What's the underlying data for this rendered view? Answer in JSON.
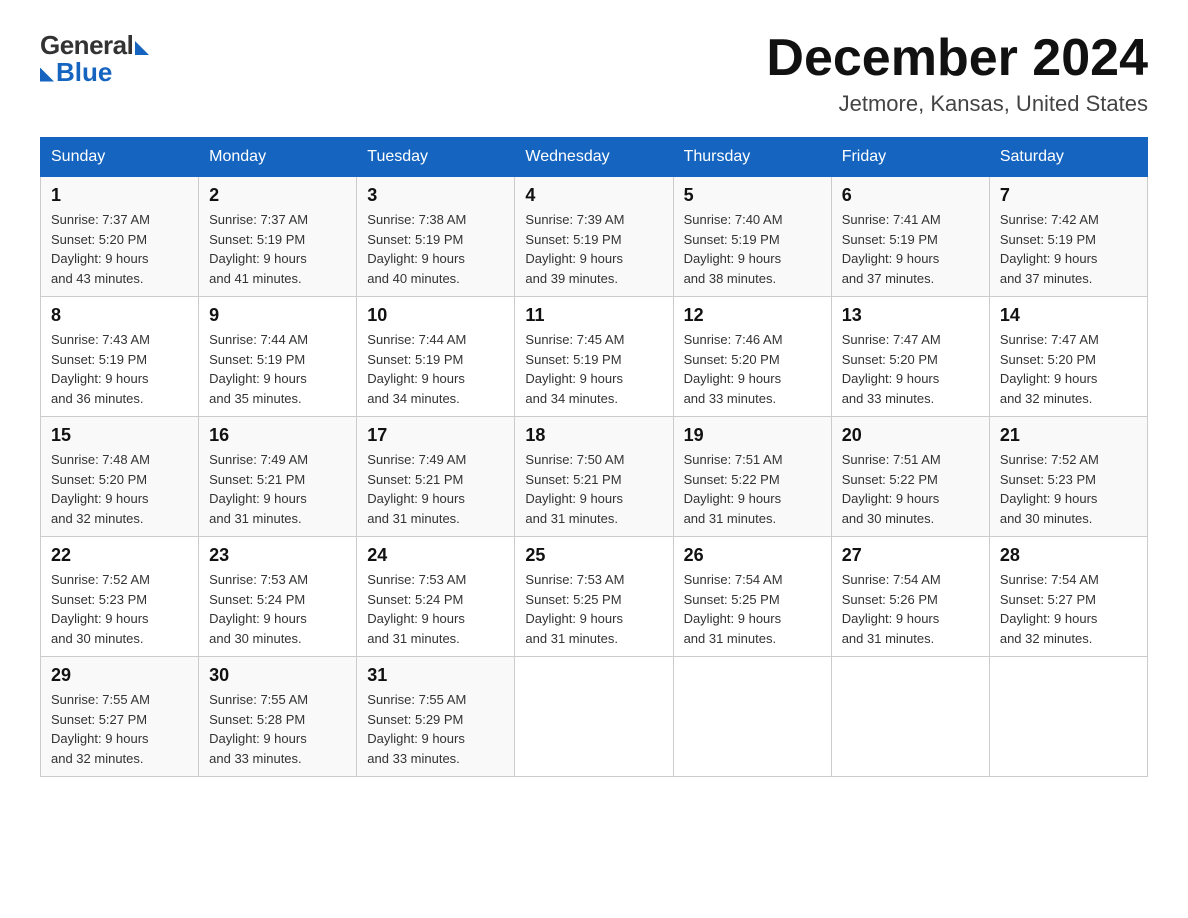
{
  "logo": {
    "general": "General",
    "blue": "Blue"
  },
  "header": {
    "month": "December 2024",
    "location": "Jetmore, Kansas, United States"
  },
  "weekdays": [
    "Sunday",
    "Monday",
    "Tuesday",
    "Wednesday",
    "Thursday",
    "Friday",
    "Saturday"
  ],
  "weeks": [
    [
      {
        "day": "1",
        "sunrise": "7:37 AM",
        "sunset": "5:20 PM",
        "daylight": "9 hours and 43 minutes."
      },
      {
        "day": "2",
        "sunrise": "7:37 AM",
        "sunset": "5:19 PM",
        "daylight": "9 hours and 41 minutes."
      },
      {
        "day": "3",
        "sunrise": "7:38 AM",
        "sunset": "5:19 PM",
        "daylight": "9 hours and 40 minutes."
      },
      {
        "day": "4",
        "sunrise": "7:39 AM",
        "sunset": "5:19 PM",
        "daylight": "9 hours and 39 minutes."
      },
      {
        "day": "5",
        "sunrise": "7:40 AM",
        "sunset": "5:19 PM",
        "daylight": "9 hours and 38 minutes."
      },
      {
        "day": "6",
        "sunrise": "7:41 AM",
        "sunset": "5:19 PM",
        "daylight": "9 hours and 37 minutes."
      },
      {
        "day": "7",
        "sunrise": "7:42 AM",
        "sunset": "5:19 PM",
        "daylight": "9 hours and 37 minutes."
      }
    ],
    [
      {
        "day": "8",
        "sunrise": "7:43 AM",
        "sunset": "5:19 PM",
        "daylight": "9 hours and 36 minutes."
      },
      {
        "day": "9",
        "sunrise": "7:44 AM",
        "sunset": "5:19 PM",
        "daylight": "9 hours and 35 minutes."
      },
      {
        "day": "10",
        "sunrise": "7:44 AM",
        "sunset": "5:19 PM",
        "daylight": "9 hours and 34 minutes."
      },
      {
        "day": "11",
        "sunrise": "7:45 AM",
        "sunset": "5:19 PM",
        "daylight": "9 hours and 34 minutes."
      },
      {
        "day": "12",
        "sunrise": "7:46 AM",
        "sunset": "5:20 PM",
        "daylight": "9 hours and 33 minutes."
      },
      {
        "day": "13",
        "sunrise": "7:47 AM",
        "sunset": "5:20 PM",
        "daylight": "9 hours and 33 minutes."
      },
      {
        "day": "14",
        "sunrise": "7:47 AM",
        "sunset": "5:20 PM",
        "daylight": "9 hours and 32 minutes."
      }
    ],
    [
      {
        "day": "15",
        "sunrise": "7:48 AM",
        "sunset": "5:20 PM",
        "daylight": "9 hours and 32 minutes."
      },
      {
        "day": "16",
        "sunrise": "7:49 AM",
        "sunset": "5:21 PM",
        "daylight": "9 hours and 31 minutes."
      },
      {
        "day": "17",
        "sunrise": "7:49 AM",
        "sunset": "5:21 PM",
        "daylight": "9 hours and 31 minutes."
      },
      {
        "day": "18",
        "sunrise": "7:50 AM",
        "sunset": "5:21 PM",
        "daylight": "9 hours and 31 minutes."
      },
      {
        "day": "19",
        "sunrise": "7:51 AM",
        "sunset": "5:22 PM",
        "daylight": "9 hours and 31 minutes."
      },
      {
        "day": "20",
        "sunrise": "7:51 AM",
        "sunset": "5:22 PM",
        "daylight": "9 hours and 30 minutes."
      },
      {
        "day": "21",
        "sunrise": "7:52 AM",
        "sunset": "5:23 PM",
        "daylight": "9 hours and 30 minutes."
      }
    ],
    [
      {
        "day": "22",
        "sunrise": "7:52 AM",
        "sunset": "5:23 PM",
        "daylight": "9 hours and 30 minutes."
      },
      {
        "day": "23",
        "sunrise": "7:53 AM",
        "sunset": "5:24 PM",
        "daylight": "9 hours and 30 minutes."
      },
      {
        "day": "24",
        "sunrise": "7:53 AM",
        "sunset": "5:24 PM",
        "daylight": "9 hours and 31 minutes."
      },
      {
        "day": "25",
        "sunrise": "7:53 AM",
        "sunset": "5:25 PM",
        "daylight": "9 hours and 31 minutes."
      },
      {
        "day": "26",
        "sunrise": "7:54 AM",
        "sunset": "5:25 PM",
        "daylight": "9 hours and 31 minutes."
      },
      {
        "day": "27",
        "sunrise": "7:54 AM",
        "sunset": "5:26 PM",
        "daylight": "9 hours and 31 minutes."
      },
      {
        "day": "28",
        "sunrise": "7:54 AM",
        "sunset": "5:27 PM",
        "daylight": "9 hours and 32 minutes."
      }
    ],
    [
      {
        "day": "29",
        "sunrise": "7:55 AM",
        "sunset": "5:27 PM",
        "daylight": "9 hours and 32 minutes."
      },
      {
        "day": "30",
        "sunrise": "7:55 AM",
        "sunset": "5:28 PM",
        "daylight": "9 hours and 33 minutes."
      },
      {
        "day": "31",
        "sunrise": "7:55 AM",
        "sunset": "5:29 PM",
        "daylight": "9 hours and 33 minutes."
      },
      null,
      null,
      null,
      null
    ]
  ],
  "labels": {
    "sunrise": "Sunrise:",
    "sunset": "Sunset:",
    "daylight": "Daylight:"
  }
}
